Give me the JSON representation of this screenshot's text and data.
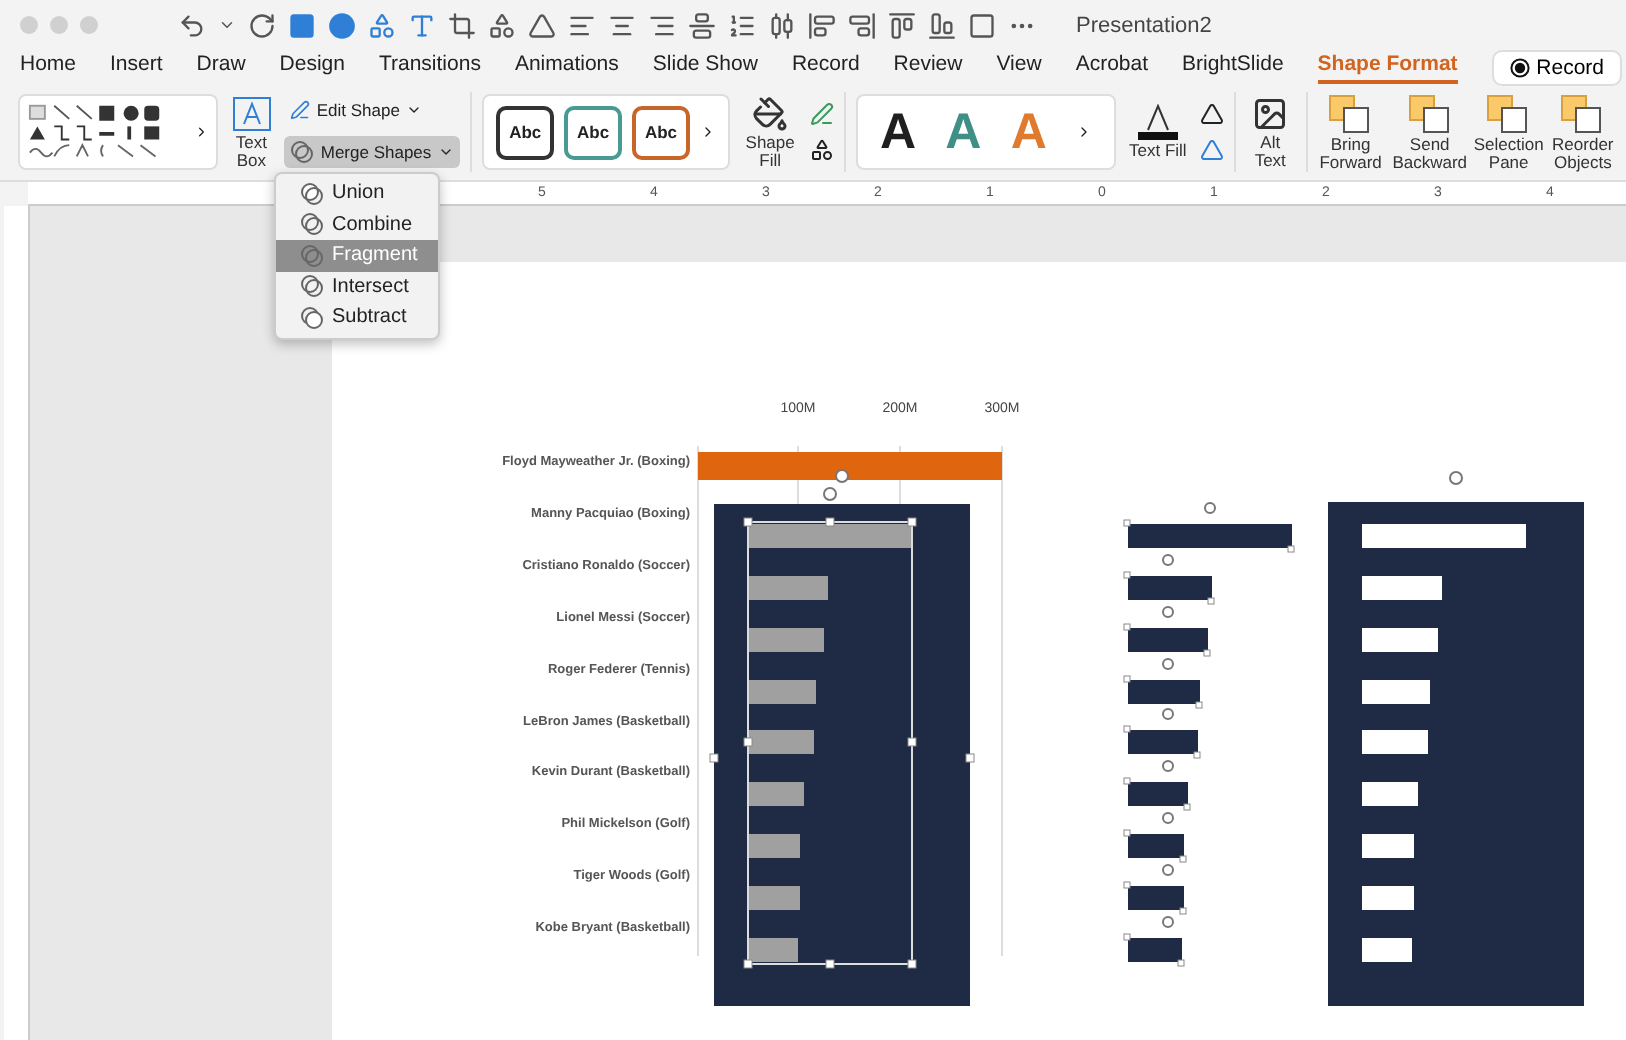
{
  "window": {
    "title": "Presentation2"
  },
  "tabs": [
    {
      "label": "Home",
      "selected": false
    },
    {
      "label": "Insert",
      "selected": false
    },
    {
      "label": "Draw",
      "selected": false
    },
    {
      "label": "Design",
      "selected": false
    },
    {
      "label": "Transitions",
      "selected": false
    },
    {
      "label": "Animations",
      "selected": false
    },
    {
      "label": "Slide Show",
      "selected": false
    },
    {
      "label": "Record",
      "selected": false
    },
    {
      "label": "Review",
      "selected": false
    },
    {
      "label": "View",
      "selected": false
    },
    {
      "label": "Acrobat",
      "selected": false
    },
    {
      "label": "BrightSlide",
      "selected": false
    },
    {
      "label": "Shape Format",
      "selected": true
    }
  ],
  "record_button": {
    "label": "Record"
  },
  "ribbon": {
    "text_box": "Text Box",
    "edit_shape": "Edit Shape",
    "merge_shapes": {
      "label": "Merge Shapes",
      "open": true
    },
    "shape_styles": [
      {
        "label": "Abc",
        "color": "#333333"
      },
      {
        "label": "Abc",
        "color": "#4a9a94"
      },
      {
        "label": "Abc",
        "color": "#c8652a"
      }
    ],
    "shape_fill": "Shape Fill",
    "wordart_styles": [
      {
        "label": "A",
        "color": "#1f1f1f"
      },
      {
        "label": "A",
        "color": "#3f8f87"
      },
      {
        "label": "A",
        "color": "#e07a2e"
      }
    ],
    "text_fill": "Text Fill",
    "alt_text": "Alt Text",
    "bring_forward": "Bring Forward",
    "send_backward": "Send Backward",
    "selection_pane": "Selection Pane",
    "reorder_objects": "Reorder Objects"
  },
  "ruler_numbers": [
    "5",
    "4",
    "3",
    "2",
    "1",
    "0",
    "1",
    "2",
    "3",
    "4"
  ],
  "merge_menu": {
    "items": [
      {
        "label": "Union",
        "selected": false
      },
      {
        "label": "Combine",
        "selected": false
      },
      {
        "label": "Fragment",
        "selected": true
      },
      {
        "label": "Intersect",
        "selected": false
      },
      {
        "label": "Subtract",
        "selected": false
      }
    ]
  },
  "slide": {
    "ticks": [
      "100M",
      "200M",
      "300M"
    ],
    "labels": [
      "Floyd Mayweather Jr. (Boxing)",
      "Manny Pacquiao (Boxing)",
      "Cristiano Ronaldo (Soccer)",
      "Lionel Messi (Soccer)",
      "Roger Federer (Tennis)",
      "LeBron James (Basketball)",
      "Kevin Durant (Basketball)",
      "Phil Mickelson (Golf)",
      "Tiger Woods (Golf)",
      "Kobe Bryant (Basketball)"
    ]
  }
}
